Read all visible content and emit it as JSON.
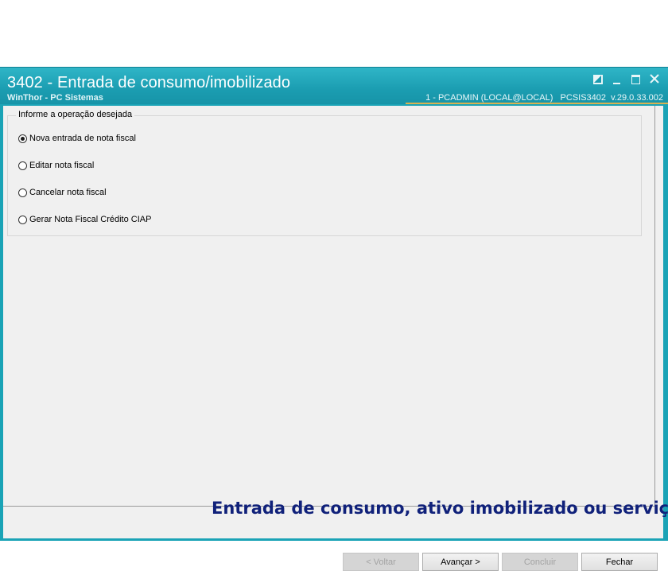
{
  "window": {
    "title": "3402 - Entrada de consumo/imobilizado",
    "app_name": "WinThor - PC Sistemas",
    "session_info": "1 - PCADMIN (LOCAL@LOCAL)   PCSIS3402  v.29.0.33.002",
    "controls": [
      "restore-icon",
      "minimize-icon",
      "maximize-icon",
      "close-icon"
    ]
  },
  "group": {
    "legend": "Informe a operação desejada",
    "options": [
      {
        "label": "Nova entrada de nota fiscal",
        "checked": true
      },
      {
        "label": "Editar nota fiscal",
        "checked": false
      },
      {
        "label": "Cancelar nota fiscal",
        "checked": false
      },
      {
        "label": "Gerar Nota Fiscal Crédito CIAP",
        "checked": false
      }
    ]
  },
  "banner": "Entrada de consumo, ativo imobilizado ou serviço",
  "buttons": {
    "back": {
      "label": "< Voltar",
      "enabled": false
    },
    "next": {
      "label": "Avançar >",
      "enabled": true
    },
    "finish": {
      "label": "Concluir",
      "enabled": false
    },
    "close": {
      "label": "Fechar",
      "enabled": true
    }
  },
  "colors": {
    "titlebar": "#1aa3b6",
    "accent_line": "#d8b252",
    "banner_text": "#10217a"
  }
}
